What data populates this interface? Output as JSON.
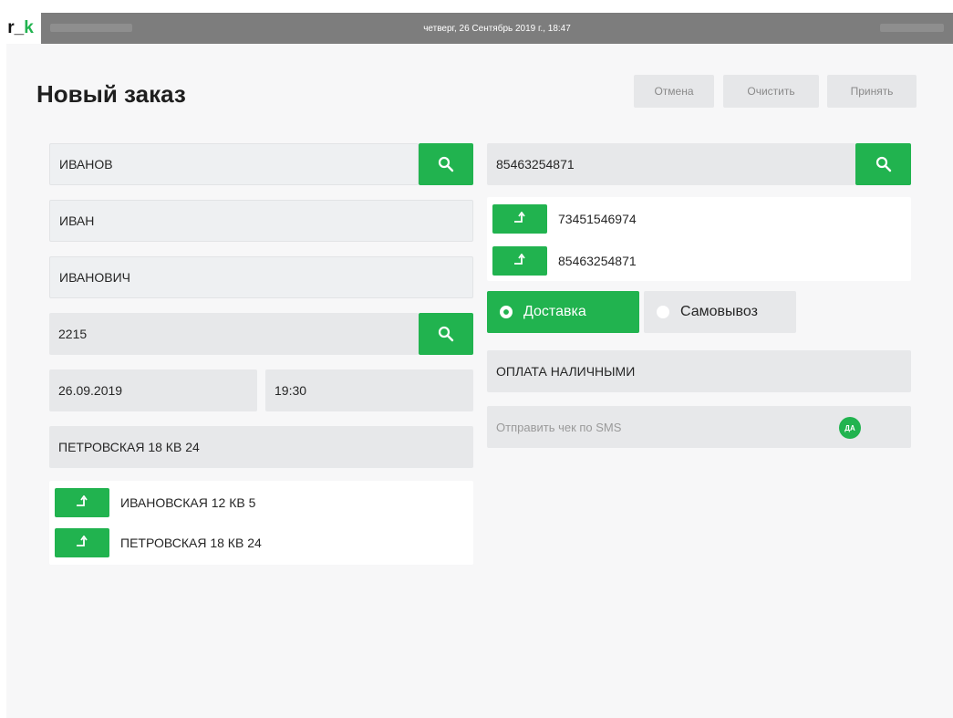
{
  "topbar": {
    "logo_prefix": "r_",
    "logo_accent": "k",
    "datetime": "четверг, 26 Сентябрь 2019 г., 18:47"
  },
  "page": {
    "title": "Новый заказ"
  },
  "toolbar": {
    "cancel_label": "Отмена",
    "clear_label": "Очистить",
    "accept_label": "Принять"
  },
  "left": {
    "last_name": "ИВАНОВ",
    "first_name": "ИВАН",
    "middle_name": "ИВАНОВИЧ",
    "code": "2215",
    "date": "26.09.2019",
    "time": "19:30",
    "address": "ПЕТРОВСКАЯ 18 КВ 24",
    "address_suggestions": [
      {
        "text": "ИВАНОВСКАЯ 12 КВ 5"
      },
      {
        "text": "ПЕТРОВСКАЯ 18 КВ 24"
      }
    ]
  },
  "right": {
    "phone": "85463254871",
    "phone_suggestions": [
      {
        "text": "73451546974"
      },
      {
        "text": "85463254871"
      }
    ],
    "delivery_label": "Доставка",
    "pickup_label": "Самовывоз",
    "delivery_selected": true,
    "payment": "ОПЛАТА НАЛИЧНЫМИ",
    "sms_placeholder": "Отправить чек по SMS",
    "sms_toggle": "ДА"
  },
  "icons": {
    "search": "search-icon",
    "select": "arrow-turn-up-icon",
    "radio": "radio-icon"
  },
  "colors": {
    "accent": "#21b34f",
    "topbar": "#7d7d7d",
    "field": "#e7e8ea",
    "page_bg": "#f7f7f8"
  }
}
